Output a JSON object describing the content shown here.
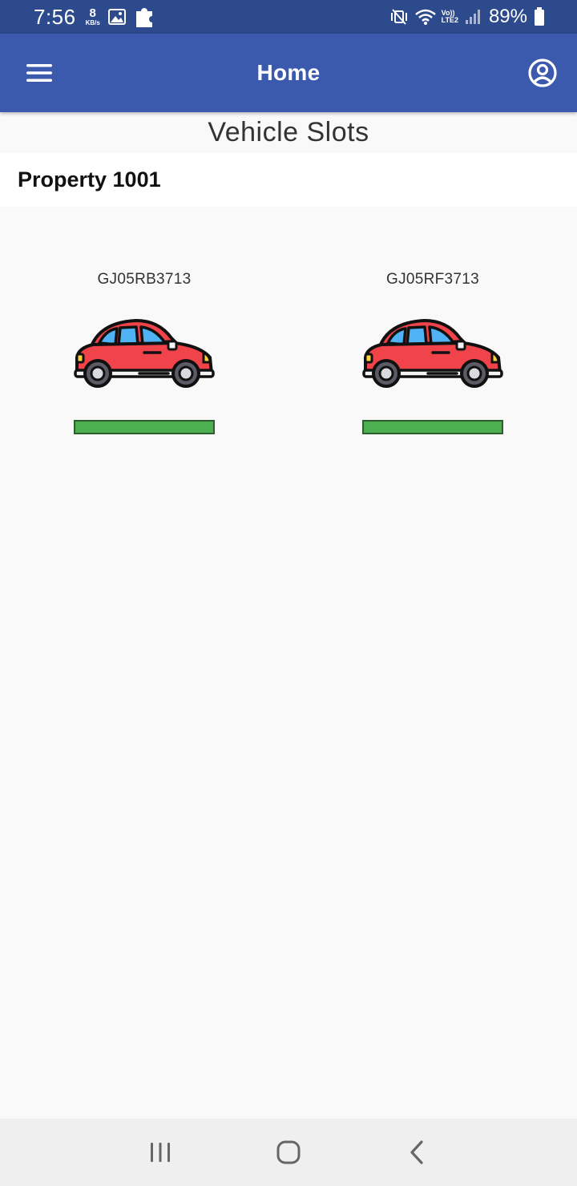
{
  "status_bar": {
    "time": "7:56",
    "net_speed_value": "8",
    "net_speed_unit": "KB/s",
    "volte_label": "Vo))",
    "lte_label": "LTE2",
    "battery_percent": "89%"
  },
  "app_bar": {
    "title": "Home",
    "menu_icon": "hamburger-menu-icon",
    "account_icon": "account-circle-icon"
  },
  "page": {
    "heading": "Vehicle Slots",
    "property_name": "Property 1001"
  },
  "slots": [
    {
      "plate": "GJ05RB3713",
      "icon": "car-icon",
      "status_fill": 1.0,
      "status_color": "#4caf50"
    },
    {
      "plate": "GJ05RF3713",
      "icon": "car-icon",
      "status_fill": 1.0,
      "status_color": "#4caf50"
    }
  ],
  "colors": {
    "status_bar": "#2c4a8c",
    "app_bar": "#3b5aae",
    "background": "#f9f9f9",
    "car_body": "#f0434a",
    "car_window": "#4fb3f6",
    "slot_available": "#4caf50"
  },
  "nav_bar": {
    "recents_icon": "recents-icon",
    "home_icon": "home-icon",
    "back_icon": "back-icon"
  }
}
